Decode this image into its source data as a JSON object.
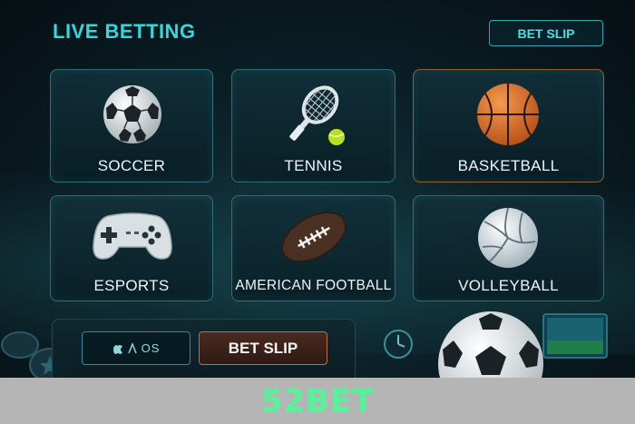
{
  "header": {
    "title": "LIVE BETTING",
    "bet_slip_label": "BET SLIP"
  },
  "tiles": [
    {
      "label": "SOCCER",
      "icon": "soccer-ball-icon"
    },
    {
      "label": "TENNIS",
      "icon": "tennis-racket-icon"
    },
    {
      "label": "BASKETBALL",
      "icon": "basketball-icon"
    },
    {
      "label": "ESPORTS",
      "icon": "gamepad-icon"
    },
    {
      "label": "AMERICAN FOOTBALL",
      "icon": "american-football-icon"
    },
    {
      "label": "VOLLEYBALL",
      "icon": "volleyball-icon"
    }
  ],
  "bottom_bar": {
    "os_text": "OS",
    "bet_slip_label": "BET SLIP"
  },
  "footer": {
    "brand": "52BET"
  },
  "colors": {
    "accent": "#2fd9e0",
    "orange": "#c46a3c",
    "brand": "#56f39a",
    "footer_bg": "#b5b5b5"
  }
}
